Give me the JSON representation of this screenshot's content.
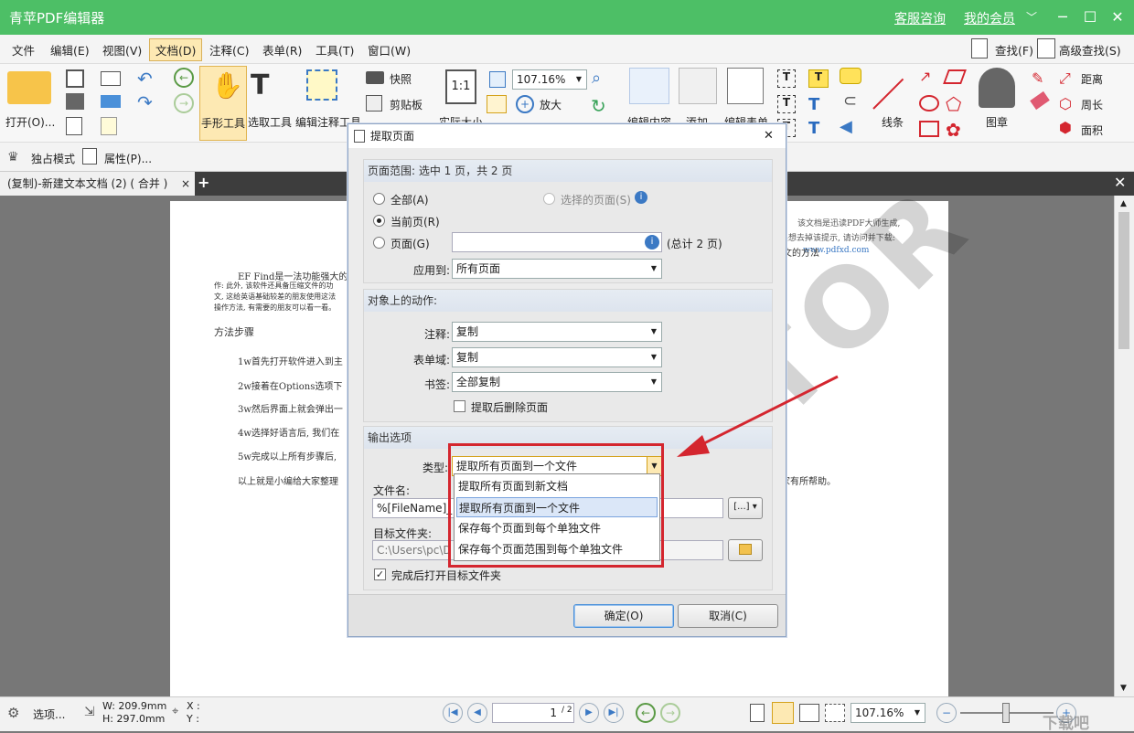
{
  "app": {
    "title": "青苹PDF编辑器",
    "service": "客服咨询",
    "member": "我的会员",
    "member_arrow": "﹀"
  },
  "menu": [
    "文件",
    "编辑(E)",
    "视图(V)",
    "文档(D)",
    "注释(C)",
    "表单(R)",
    "工具(T)",
    "窗口(W)"
  ],
  "search": {
    "find": "查找(F)",
    "advanced": "高级查找(S)"
  },
  "ribbon": {
    "open": "打开(O)...",
    "hand": "手形工具",
    "select": "选取工具",
    "edit_note": "编辑注释工具",
    "actual": "实际大小",
    "zoom": "107.16%",
    "zoom_in": "放大",
    "snapshot": "快照",
    "clipboard": "剪贴板",
    "edit_content": "编辑内容",
    "add": "添加",
    "edit_form": "编辑表单",
    "line": "线条",
    "stamp": "图章",
    "distance": "距离",
    "perimeter": "周长",
    "area": "面积"
  },
  "subbar": {
    "exclusive": "独占模式",
    "properties": "属性(P)..."
  },
  "tab": {
    "label": "(复制)-新建文本文档 (2) ( 合并 )",
    "close": "×",
    "add": "+"
  },
  "document": {
    "para": "EF Find是一法功能强大的",
    "para2": "作: 此外, 该软件还具备压缩文件的功",
    "para3": "文, 这给英语基础较差的朋友使用这法",
    "para4": "操作方法, 有需要的朋友可以看一看。",
    "steps_title": "方法步骤",
    "steps": [
      "1w首先打开软件进入到主",
      "2w接着在Options选项下",
      "3w然后界面上就会弹出一",
      "4w选择好语言后, 我们在",
      "5w完成以上所有步骤后,",
      "以上就是小编给大家整理"
    ],
    "note1": "该文档是迅读PDF大师生成,",
    "note2": "如果想去掉该提示, 请访问并下载:",
    "url": "www.pdfxd.com",
    "method": "文的方法",
    "help": "家有所帮助。",
    "watermark": "EDITOR"
  },
  "dialog": {
    "title": "提取页面",
    "close": "✕",
    "range_head": "页面范围: 选中 1 页，共 2 页",
    "all": "全部(A)",
    "selected": "选择的页面(S)",
    "current": "当前页(R)",
    "pages": "页面(G)",
    "total": "(总计 2 页)",
    "apply_label": "应用到:",
    "apply_value": "所有页面",
    "actions_head": "对象上的动作:",
    "note_label": "注释:",
    "note_value": "复制",
    "form_label": "表单域:",
    "form_value": "复制",
    "bookmark_label": "书签:",
    "bookmark_value": "全部复制",
    "delete_after": "提取后删除页面",
    "output_head": "输出选项",
    "type_label": "类型:",
    "type_value": "提取所有页面到一个文件",
    "options": [
      "提取所有页面到新文档",
      "提取所有页面到一个文件",
      "保存每个页面到每个单独文件",
      "保存每个页面范围到每个单独文件"
    ],
    "filename_label": "文件名:",
    "filename_value": "%[FileName]_",
    "folder_label": "目标文件夹:",
    "folder_value": "C:\\Users\\pc\\D",
    "open_after": "完成后打开目标文件夹",
    "ok": "确定(O)",
    "cancel": "取消(C)"
  },
  "status": {
    "options": "选项...",
    "w": "W: 209.9mm",
    "h": "H: 297.0mm",
    "x": "X :",
    "y": "Y :",
    "page": "1",
    "page_total": "/ 2",
    "zoom": "107.16%",
    "brand": "下载吧"
  },
  "colors": {
    "titlebar": "#4dbf66",
    "annotation": "#d4262f"
  }
}
